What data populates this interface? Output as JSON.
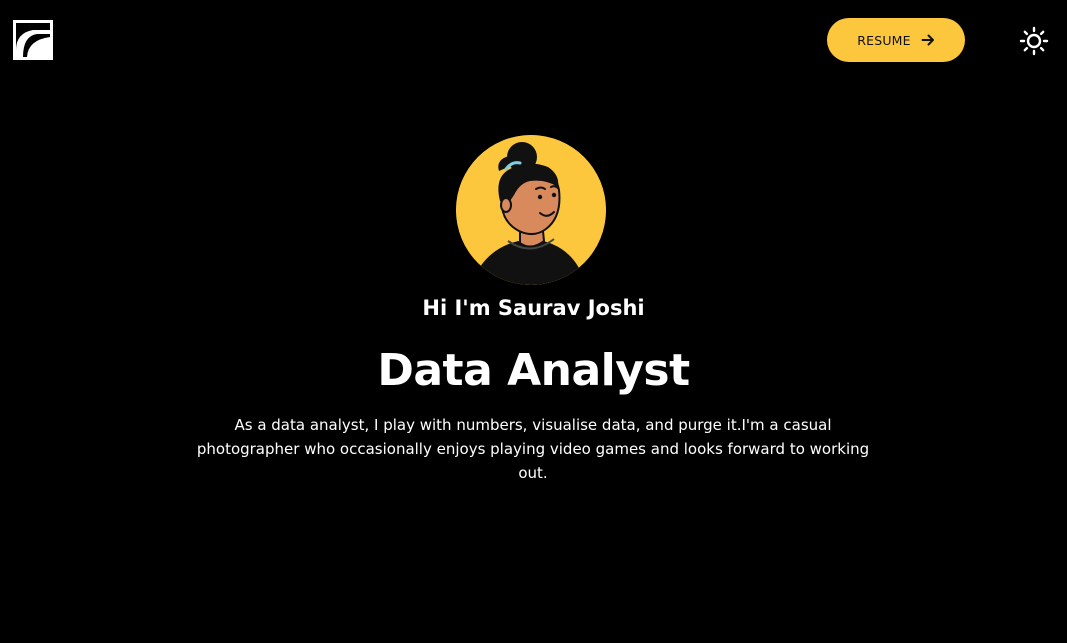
{
  "header": {
    "logo_icon": "square-arc-logo-icon",
    "resume_label": "RESUME",
    "resume_icon": "arrow-right-icon",
    "theme_toggle_icon": "sun-icon"
  },
  "hero": {
    "avatar_icon": "cartoon-avatar",
    "greeting": "Hi I'm Saurav Joshi",
    "role": "Data Analyst",
    "bio": "As a data analyst, I play with numbers, visualise data, and purge it.I'm a casual photographer who occasionally enjoys playing video games and looks forward to working out."
  },
  "colors": {
    "background": "#000000",
    "accent": "#fdc73d",
    "text": "#ffffff"
  }
}
